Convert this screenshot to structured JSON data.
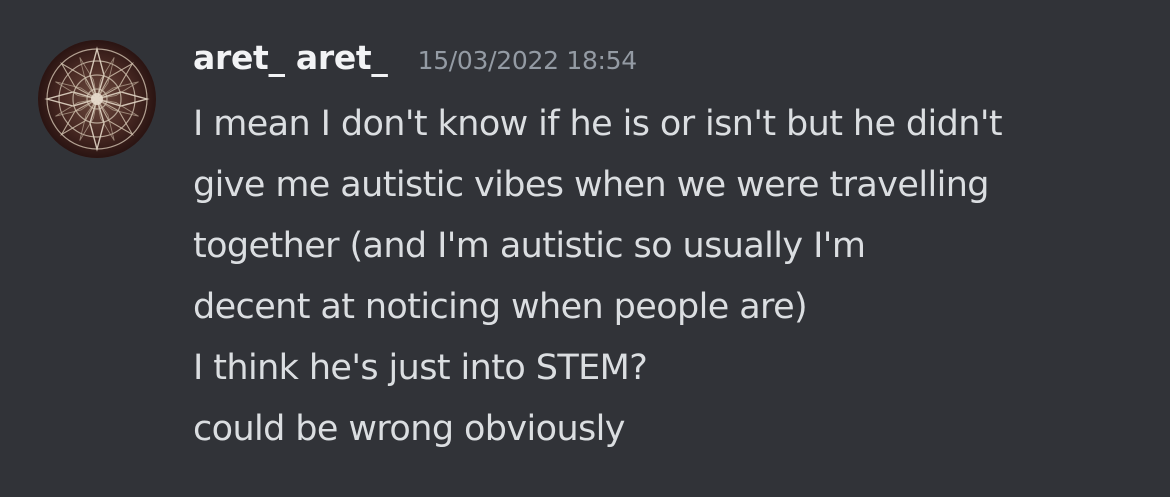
{
  "message": {
    "author": "aret_ aret_",
    "timestamp": "15/03/2022 18:54",
    "avatar_icon": "mandala-avatar",
    "lines": [
      "I mean I don't know if he is or isn't but he didn't",
      "give me autistic vibes when we were travelling",
      "together (and I'm autistic so usually I'm",
      "decent at noticing when people are)",
      "I think he's just into STEM?",
      "could be wrong obviously"
    ]
  },
  "colors": {
    "background": "#313338",
    "username": "#f2f3f5",
    "timestamp": "#949ba4",
    "text": "#dbdee1"
  }
}
